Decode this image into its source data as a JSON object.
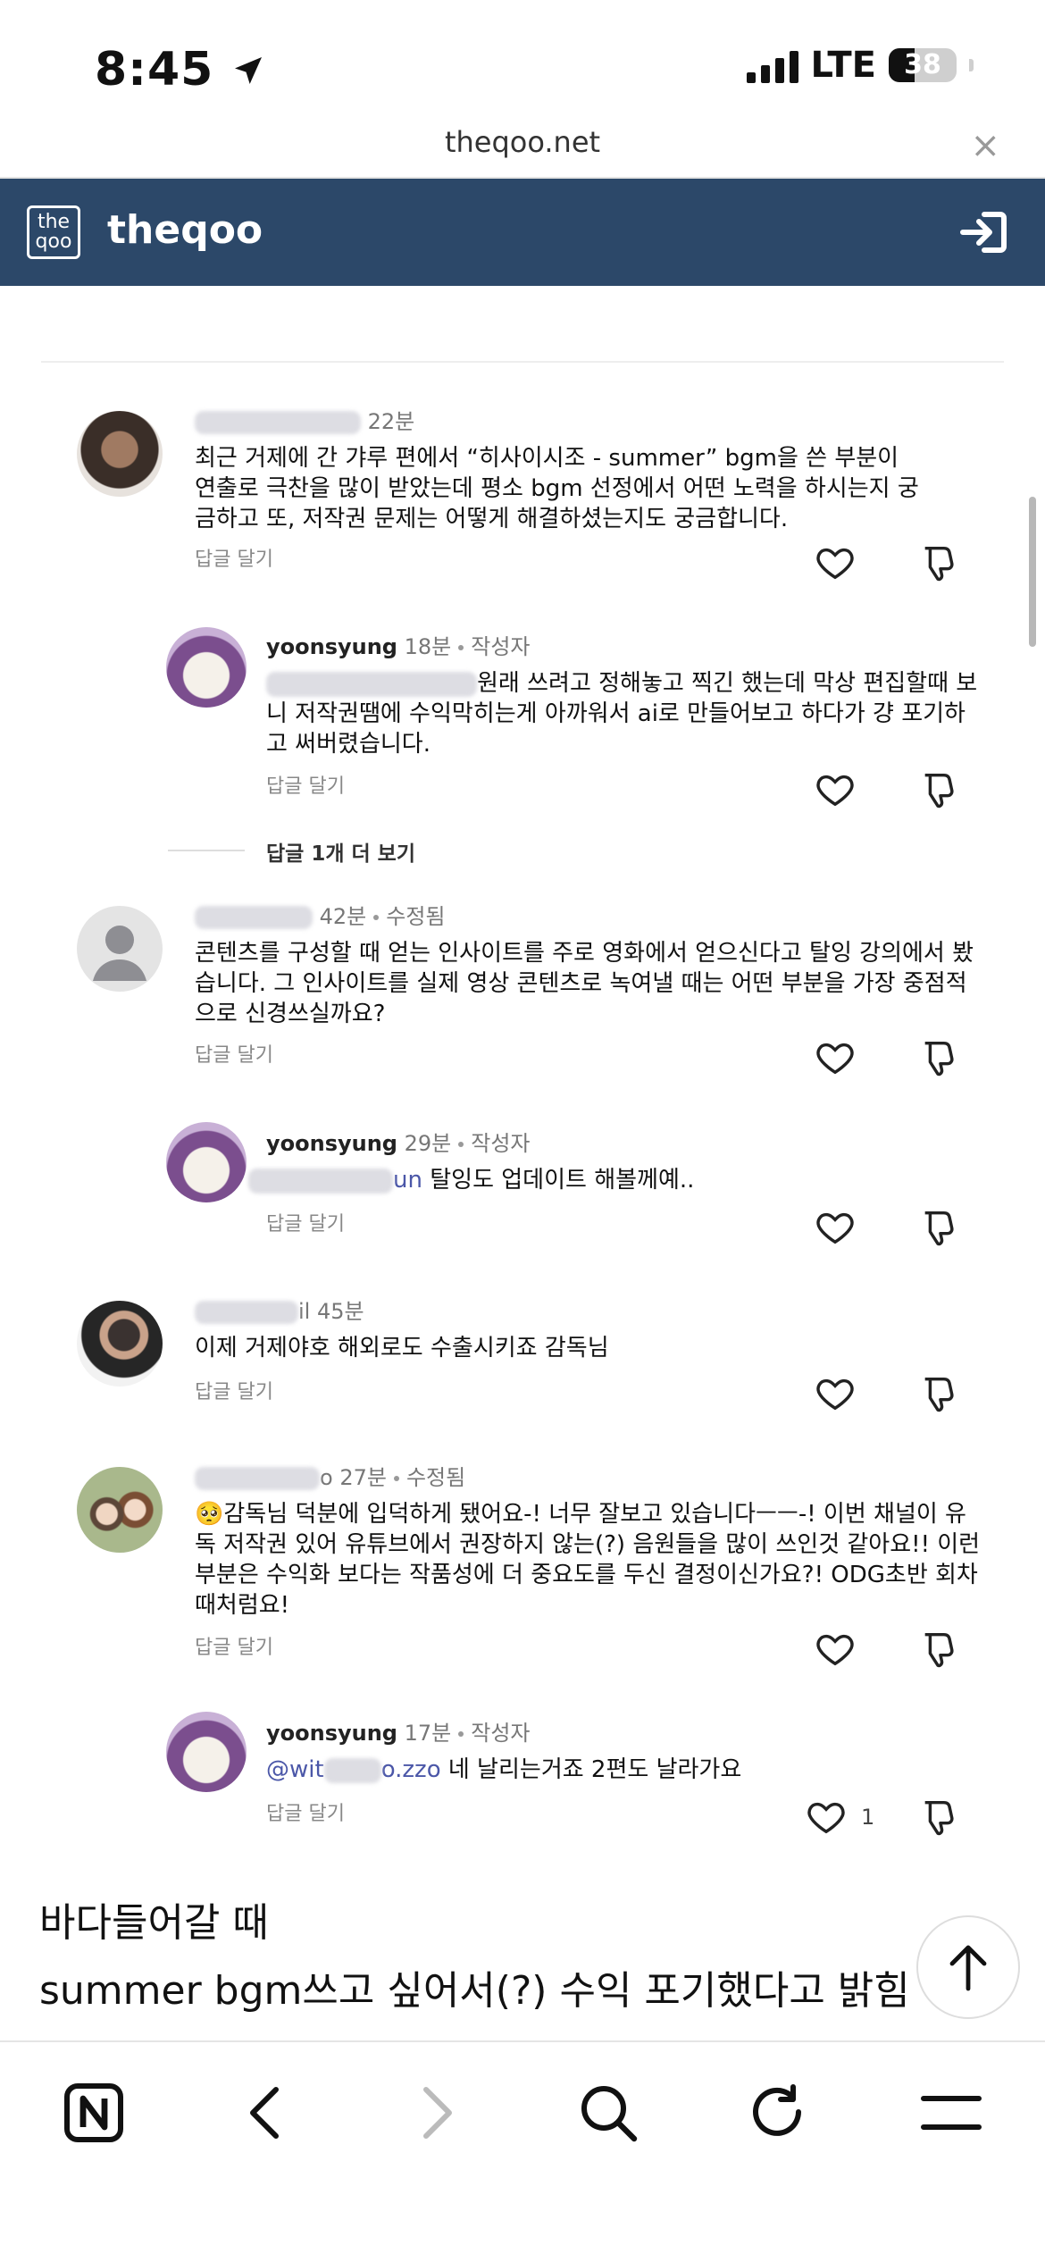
{
  "status": {
    "time": "8:45",
    "network": "LTE",
    "battery": "38"
  },
  "browser": {
    "url": "theqoo.net",
    "close_label": "×"
  },
  "site": {
    "logo_text": "the qoo",
    "name": "theqoo"
  },
  "comments": [
    {
      "time": "22분",
      "text": "최근 거제에 간 갸루 편에서 “히사이시조 - summer” bgm을 쓴 부분이 연출로 극찬을 많이 받았는데 평소 bgm 선정에서 어떤 노력을 하시는지 궁금하고 또, 저작권 문제는 어떻게 해결하셨는지도 궁금합니다.",
      "reply_label": "답글 달기"
    },
    {
      "author": "yoonsyung",
      "time": "18분",
      "author_tag": "작성자",
      "text": "원래 쓰려고 정해놓고 찍긴 했는데 막상 편집할때 보니 저작권땜에 수익막히는게 아까워서 ai로 만들어보고 하다가 걍 포기하고 써버렸습니다.",
      "reply_label": "답글 달기"
    },
    {
      "time": "42분",
      "edited": "수정됨",
      "text": "콘텐츠를 구성할 때 얻는 인사이트를 주로 영화에서 얻으신다고 탈잉 강의에서 봤습니다. 그 인사이트를 실제 영상 콘텐츠로 녹여낼 때는 어떤 부분을 가장 중점적으로 신경쓰실까요?",
      "reply_label": "답글 달기"
    },
    {
      "author": "yoonsyung",
      "time": "29분",
      "author_tag": "작성자",
      "mention_tail": "un",
      "text": " 탈잉도 업데이트 해볼께예..",
      "reply_label": "답글 달기"
    },
    {
      "name_tail": "il",
      "time": "45분",
      "text": "이제 거제야호 해외로도 수출시키죠 감독님",
      "reply_label": "답글 달기"
    },
    {
      "name_tail": "o",
      "time": "27분",
      "edited": "수정됨",
      "emoji": "🥺",
      "text": "감독님 덕분에 입덕하게 됐어요-! 너무 잘보고 있습니다ㅡㅡ-! 이번 채널이 유독 저작권 있어 유튜브에서 권장하지 않는(?) 음원들을 많이 쓰인것 같아요!! 이런 부분은 수익화 보다는 작품성에 더 중요도를 두신 결정이신가요?! ODG초반 회차때처럼요!",
      "reply_label": "답글 달기"
    },
    {
      "author": "yoonsyung",
      "time": "17분",
      "author_tag": "작성자",
      "mention_head": "@wit",
      "mention_tail": "o.zzo",
      "text": " 네 날리는거죠 2편도 날라가요",
      "reply_label": "답글 달기",
      "likes": "1"
    }
  ],
  "more_replies": "답글 1개 더 보기",
  "caption": {
    "line1": "바다들어갈 때",
    "line2": "summer bgm쓰고 싶어서(?) 수익 포기했다고 밝힘"
  },
  "colors": {
    "header_bg": "#2c4869",
    "mention": "#4b57a8"
  },
  "toolbar_icons": [
    "naver-n-icon",
    "back-icon",
    "forward-icon",
    "search-icon",
    "reload-icon",
    "menu-icon"
  ]
}
